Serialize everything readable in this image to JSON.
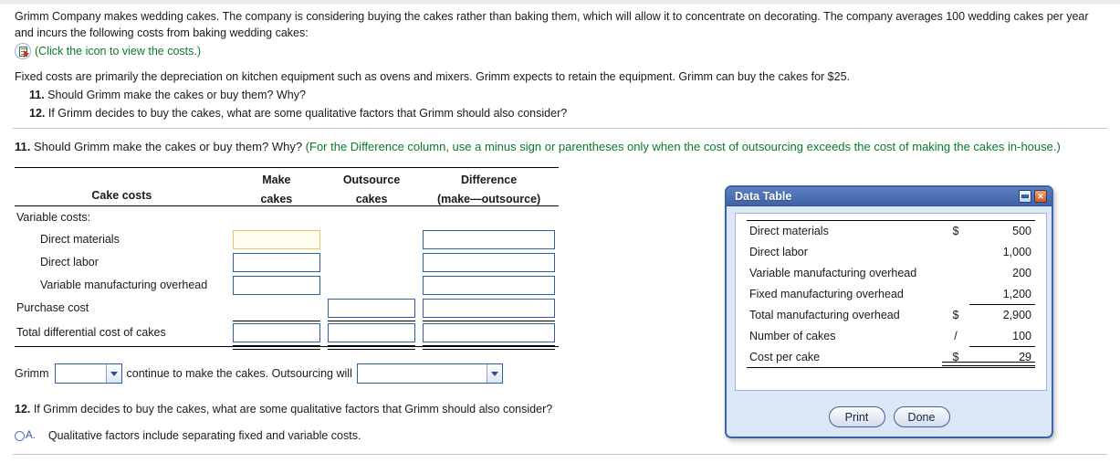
{
  "intro": {
    "paragraph": "Grimm Company makes wedding cakes. The company is considering buying the cakes rather than baking them, which will allow it to concentrate on decorating. The company averages 100 wedding cakes per year and incurs the following costs from baking wedding cakes:",
    "icon_hint": "(Click the icon to view the costs.)",
    "icon_name": "spreadsheet-link-icon",
    "fixed_costs_note": "Fixed costs are primarily the depreciation on kitchen equipment such as ovens and mixers. Grimm expects to retain the equipment. Grimm can buy the cakes for $25.",
    "q11_number": "11.",
    "q11_text": "Should Grimm make the cakes or buy them? Why?",
    "q12_number": "12.",
    "q12_text": "If Grimm decides to buy the cakes, what are some qualitative factors that Grimm should also consider?"
  },
  "question11": {
    "number": "11.",
    "prompt": "Should Grimm make the cakes or buy them? Why?",
    "hint": "(For the Difference column, use a minus sign or parentheses only when the cost of outsourcing exceeds the cost of making the cakes in-house.)"
  },
  "answer_table": {
    "headers": {
      "label": "Cake costs",
      "col1_line1": "Make",
      "col1_line2": "cakes",
      "col2_line1": "Outsource",
      "col2_line2": "cakes",
      "col3_line1": "Difference",
      "col3_line2": "(make—outsource)"
    },
    "rows": [
      {
        "label": "Variable costs:",
        "indent": 0,
        "inputs": [
          false,
          false,
          false
        ]
      },
      {
        "label": "Direct materials",
        "indent": 1,
        "inputs": [
          true,
          false,
          true
        ],
        "active": 0
      },
      {
        "label": "Direct labor",
        "indent": 1,
        "inputs": [
          true,
          false,
          true
        ]
      },
      {
        "label": "Variable manufacturing overhead",
        "indent": 1,
        "inputs": [
          true,
          false,
          true
        ]
      },
      {
        "label": "Purchase cost",
        "indent": 0,
        "inputs": [
          false,
          true,
          true
        ]
      },
      {
        "label": "Total differential cost of cakes",
        "indent": 0,
        "inputs": [
          true,
          true,
          true
        ]
      }
    ],
    "input_values": [
      "",
      "",
      "",
      "",
      "",
      "",
      "",
      "",
      "",
      "",
      "",
      ""
    ]
  },
  "conclusion": {
    "prefix": "Grimm",
    "dropdown1_value": "",
    "middle": "continue to make the cakes. Outsourcing will",
    "dropdown2_value": ""
  },
  "question12": {
    "number": "12.",
    "prompt": "If Grimm decides to buy the cakes, what are some qualitative factors that Grimm should also consider?",
    "options": [
      {
        "letter": "A.",
        "text": "Qualitative factors include separating fixed and variable costs."
      }
    ]
  },
  "dialog": {
    "title": "Data Table",
    "minimize_label": "minimize",
    "close_label": "✕",
    "rows": [
      {
        "label": "Direct materials",
        "symbol": "$",
        "value": "500",
        "rule": ""
      },
      {
        "label": "Direct labor",
        "symbol": "",
        "value": "1,000",
        "rule": ""
      },
      {
        "label": "Variable manufacturing overhead",
        "symbol": "",
        "value": "200",
        "rule": ""
      },
      {
        "label": "Fixed manufacturing overhead",
        "symbol": "",
        "value": "1,200",
        "rule": "single"
      },
      {
        "label": "Total manufacturing overhead",
        "symbol": "$",
        "value": "2,900",
        "rule": ""
      },
      {
        "label": "Number of cakes",
        "symbol": "/",
        "value": "100",
        "rule": "single"
      },
      {
        "label": "Cost per cake",
        "symbol": "$",
        "value": "29",
        "rule": "double"
      }
    ],
    "print_label": "Print",
    "done_label": "Done"
  },
  "colors": {
    "accent_blue": "#2f5fa8",
    "dialog_header": "#3f63a6",
    "hint_green": "#0a7a2a",
    "active_field": "#e8c75c"
  }
}
